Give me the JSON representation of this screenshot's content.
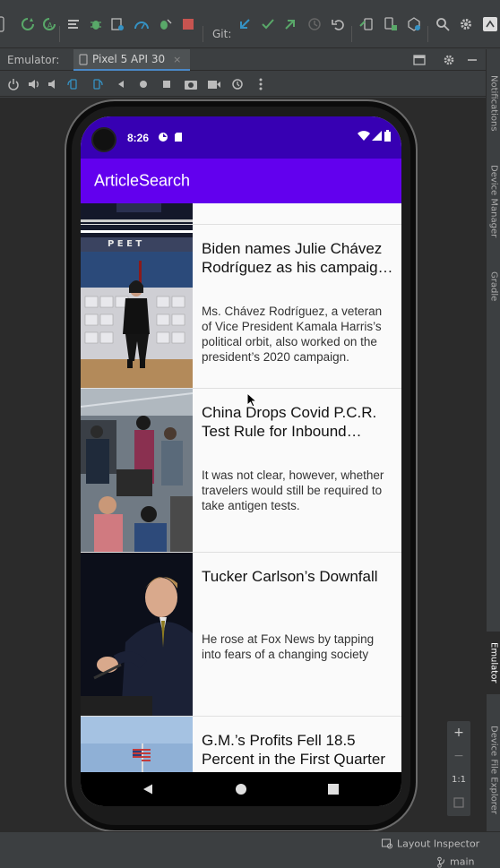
{
  "toolbar": {
    "git_label": "Git:",
    "icons": [
      "sync-icon",
      "apply-changes-icon",
      "make-icon",
      "debug-icon",
      "profile-icon",
      "attach-debugger-icon",
      "stop-icon",
      "git-update-icon",
      "git-commit-icon",
      "git-push-icon",
      "history-icon",
      "rollback-icon",
      "device-manager-icon",
      "search-icon",
      "settings-icon"
    ],
    "colors": {
      "green": "#59a869",
      "blue": "#3592c4",
      "red": "#c75450"
    }
  },
  "emulator": {
    "label": "Emulator:",
    "tab_label": "Pixel 5 API 30",
    "tab_close": "×"
  },
  "right_strip": {
    "tabs": [
      "Notifications",
      "Device Manager",
      "Gradle",
      "Emulator",
      "Device File Explorer"
    ]
  },
  "zoom": {
    "in": "+",
    "out": "−",
    "one_to_one": "1:1"
  },
  "device": {
    "time": "8:26",
    "app_title": "ArticleSearch",
    "colors": {
      "status_bar": "#3700b3",
      "app_bar": "#6200ee"
    }
  },
  "articles": [
    {
      "headline": "Biden names Julie Chávez Rodríguez as his campaign manager",
      "abstract": "Ms. Chávez Rodríguez, a veteran of Vice President Kamala Harris’s political orbit, also worked on the president’s 2020 campaign."
    },
    {
      "headline": "China Drops Covid P.C.R. Test Rule for Inbound Travelers",
      "abstract": "It was not clear, however, whether travelers would still be required to take antigen tests."
    },
    {
      "headline": "Tucker Carlson’s Downfall",
      "abstract": "He rose at Fox News by tapping into fears of a changing society"
    },
    {
      "headline": "G.M.’s Profits Fell 18.5 Percent in the First Quarter",
      "abstract": ""
    }
  ],
  "status": {
    "layout_inspector": "Layout Inspector",
    "branch": "main"
  }
}
